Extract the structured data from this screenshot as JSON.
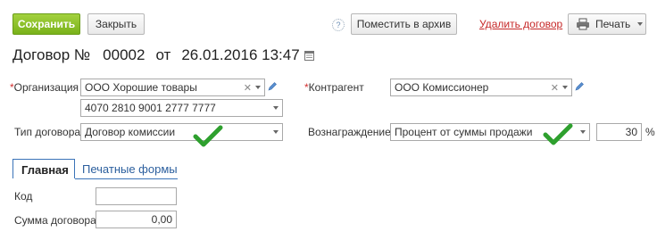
{
  "toolbar": {
    "save_label": "Сохранить",
    "close_label": "Закрыть",
    "help_label": "?",
    "archive_label": "Поместить в архив",
    "delete_label": "Удалить договор",
    "print_label": "Печать"
  },
  "title": {
    "doc_label": "Договор №",
    "number": "00002",
    "from_label": "от",
    "datetime": "26.01.2016 13:47"
  },
  "form": {
    "organization": {
      "label": "Организация",
      "value": "ООО Хорошие товары",
      "account": "4070 2810 9001 2777 7777"
    },
    "counterparty": {
      "label": "Контрагент",
      "value": "ООО Комиссионер"
    },
    "contract_type": {
      "label": "Тип договора",
      "value": "Договор комиссии"
    },
    "reward": {
      "label": "Вознаграждение",
      "value": "Процент от суммы продажи",
      "percent": "30",
      "unit": "%"
    }
  },
  "tabs": [
    {
      "label": "Главная"
    },
    {
      "label": "Печатные формы"
    }
  ],
  "main": {
    "code_label": "Код",
    "code_value": "",
    "sum_label": "Сумма договора",
    "sum_value": "0,00"
  },
  "colors": {
    "primary": "#8cc22b",
    "checkmark": "#2ea02e",
    "required": "#d32f2f",
    "tab_active_border": "#3a73b8"
  }
}
